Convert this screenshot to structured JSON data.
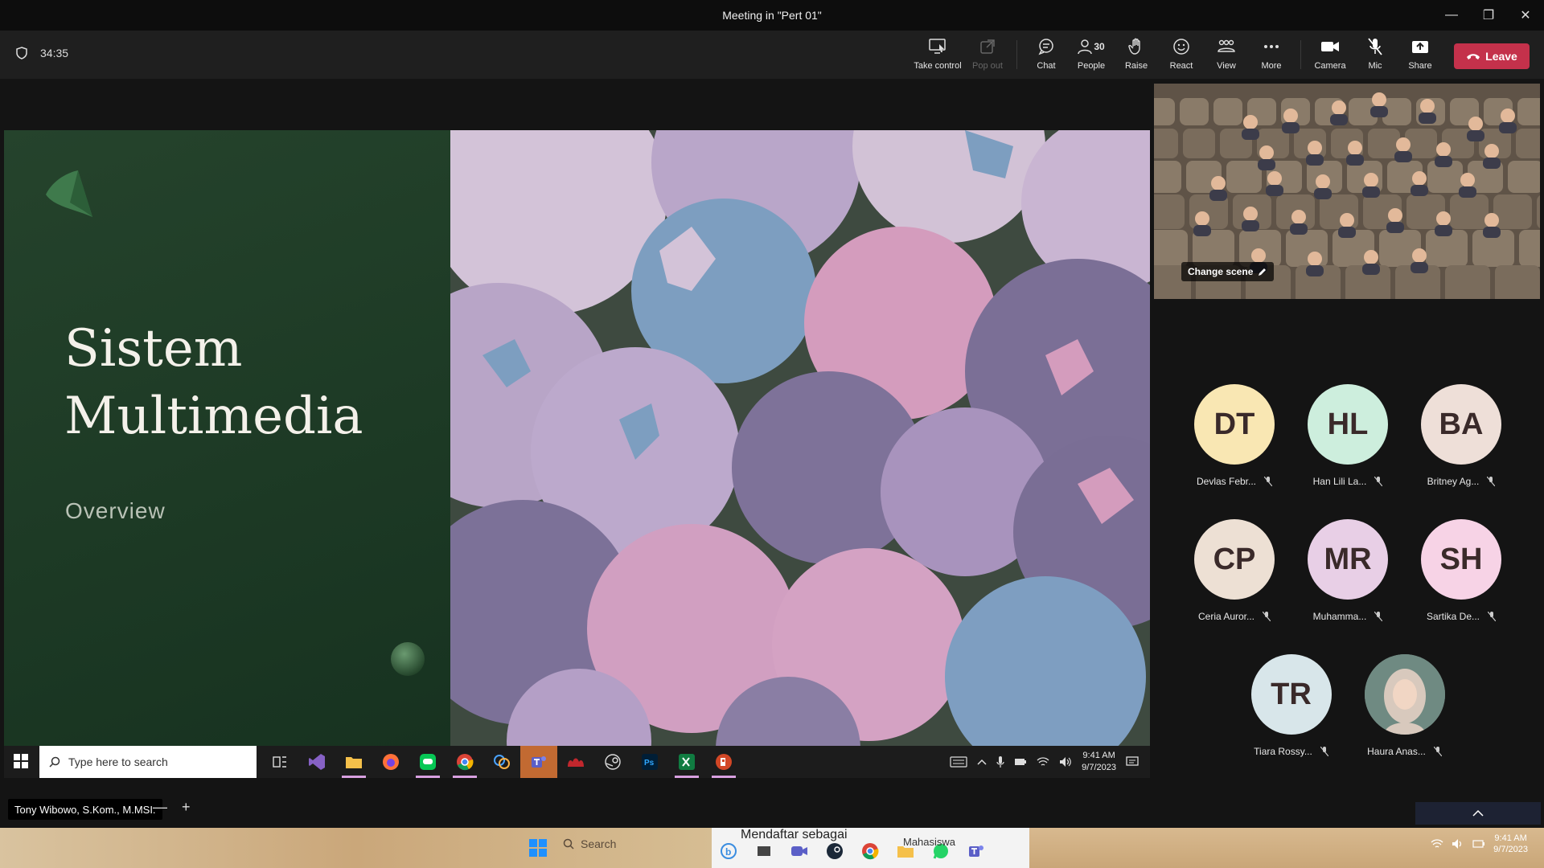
{
  "window": {
    "title": "Meeting in \"Pert 01\""
  },
  "toolbar": {
    "timer": "34:35",
    "take_control": "Take control",
    "pop_out": "Pop out",
    "chat": "Chat",
    "people": "People",
    "people_count": "30",
    "raise": "Raise",
    "react": "React",
    "view": "View",
    "more": "More",
    "camera": "Camera",
    "mic": "Mic",
    "share": "Share",
    "leave": "Leave"
  },
  "slide": {
    "title_line1": "Sistem",
    "title_line2": "Multimedia",
    "subtitle": "Overview"
  },
  "presenter": {
    "name": "Tony Wibowo, S.Kom., M.MSI."
  },
  "remote_taskbar": {
    "search_placeholder": "Type here to search",
    "time": "9:41 AM",
    "date": "9/7/2023"
  },
  "together_mode": {
    "change_scene": "Change scene"
  },
  "participants": [
    {
      "initials": "DT",
      "name": "Devlas Febr...",
      "color": "#f9e7b3"
    },
    {
      "initials": "HL",
      "name": "Han Lili La...",
      "color": "#cdeedd"
    },
    {
      "initials": "BA",
      "name": "Britney Ag...",
      "color": "#eedfd8"
    },
    {
      "initials": "CP",
      "name": "Ceria Auror...",
      "color": "#ede0d4"
    },
    {
      "initials": "MR",
      "name": "Muhamma...",
      "color": "#e8cfe6"
    },
    {
      "initials": "SH",
      "name": "Sartika De...",
      "color": "#f7d3e6"
    },
    {
      "initials": "TR",
      "name": "Tiara Rossy...",
      "color": "#d8e6ea"
    },
    {
      "initials": "",
      "name": "Haura Anas...",
      "color": "#7a8f88"
    }
  ],
  "local_taskbar": {
    "search": "Search",
    "notification": "Mendaftar sebagai",
    "app_label": "Mahasiswa",
    "time": "9:41 AM",
    "date": "9/7/2023"
  }
}
